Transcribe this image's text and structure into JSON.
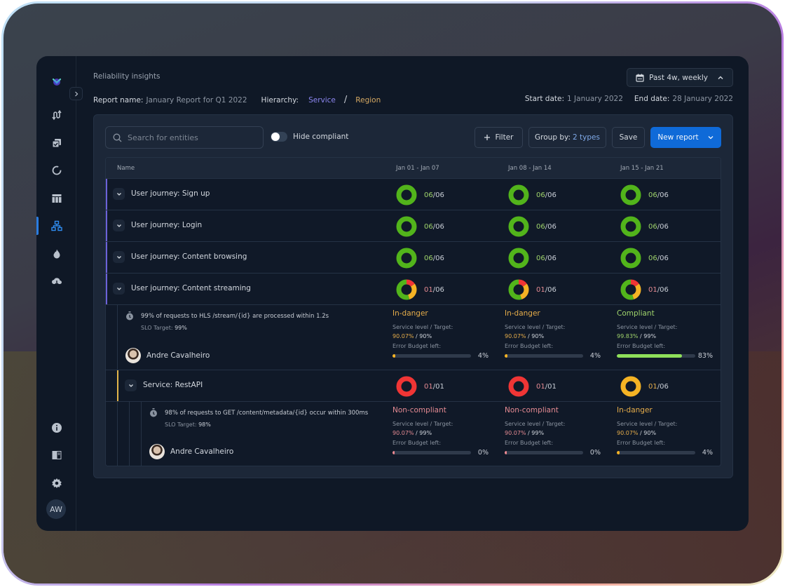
{
  "app": {
    "page_title": "Reliability insights",
    "user_initials": "AW"
  },
  "sidebar": {
    "items": [
      {
        "icon": "logo-icon",
        "active": false
      },
      {
        "icon": "route-icon",
        "active": false
      },
      {
        "icon": "copy-check-icon",
        "active": false
      },
      {
        "icon": "refresh-circle-icon",
        "active": false
      },
      {
        "icon": "table-icon",
        "active": false
      },
      {
        "icon": "hierarchy-icon",
        "active": true
      },
      {
        "icon": "flame-icon",
        "active": false
      },
      {
        "icon": "cloud-download-icon",
        "active": false
      }
    ],
    "bottom_items": [
      {
        "icon": "info-icon"
      },
      {
        "icon": "book-icon"
      },
      {
        "icon": "settings-icon"
      }
    ]
  },
  "header": {
    "report_name_label": "Report name:",
    "report_name_value": "January Report for Q1 2022",
    "hierarchy_label": "Hierarchy:",
    "hierarchy_service": "Service",
    "hierarchy_separator": "/",
    "hierarchy_region": "Region",
    "date_range_button": "Past 4w, weekly",
    "start_date_label": "Start date:",
    "start_date_value": "1 January 2022",
    "end_date_label": "End date:",
    "end_date_value": "28 January 2022"
  },
  "toolbar": {
    "search_placeholder": "Search for entities",
    "hide_compliant_label": "Hide compliant",
    "hide_compliant_on": false,
    "filter_label": "Filter",
    "group_by_label": "Group by:",
    "group_by_value": "2 types",
    "save_label": "Save",
    "new_report_label": "New report"
  },
  "table": {
    "columns": [
      "Name",
      "Jan 01 - Jan 07",
      "Jan 08 - Jan 14",
      "Jan 15 - Jan 21"
    ],
    "journeys": [
      {
        "name": "User journey: Sign up",
        "weeks": [
          {
            "ok": "06",
            "total": "06",
            "segments": {
              "green": 1,
              "orange": 0,
              "red": 0
            }
          },
          {
            "ok": "06",
            "total": "06",
            "segments": {
              "green": 1,
              "orange": 0,
              "red": 0
            }
          },
          {
            "ok": "06",
            "total": "06",
            "segments": {
              "green": 1,
              "orange": 0,
              "red": 0
            }
          }
        ]
      },
      {
        "name": "User journey: Login",
        "weeks": [
          {
            "ok": "06",
            "total": "06",
            "segments": {
              "green": 1,
              "orange": 0,
              "red": 0
            }
          },
          {
            "ok": "06",
            "total": "06",
            "segments": {
              "green": 1,
              "orange": 0,
              "red": 0
            }
          },
          {
            "ok": "06",
            "total": "06",
            "segments": {
              "green": 1,
              "orange": 0,
              "red": 0
            }
          }
        ]
      },
      {
        "name": "User journey: Content browsing",
        "weeks": [
          {
            "ok": "06",
            "total": "06",
            "segments": {
              "green": 1,
              "orange": 0,
              "red": 0
            }
          },
          {
            "ok": "06",
            "total": "06",
            "segments": {
              "green": 1,
              "orange": 0,
              "red": 0
            }
          },
          {
            "ok": "06",
            "total": "06",
            "segments": {
              "green": 1,
              "orange": 0,
              "red": 0
            }
          }
        ]
      },
      {
        "name": "User journey: Content streaming",
        "weeks": [
          {
            "ok": "01",
            "total": "06",
            "segments": {
              "green": 0.55,
              "orange": 0.3,
              "red": 0.15
            }
          },
          {
            "ok": "01",
            "total": "06",
            "segments": {
              "green": 0.55,
              "orange": 0.3,
              "red": 0.15
            }
          },
          {
            "ok": "01",
            "total": "06",
            "segments": {
              "green": 0.55,
              "orange": 0.3,
              "red": 0.15
            }
          }
        ]
      }
    ],
    "streaming_slo": {
      "text": "99% of requests to HLS /stream/{id} are processed within 1.2s",
      "target_label": "SLO Target:",
      "target_value": "99%",
      "owner": "Andre Cavalheiro",
      "weeks": [
        {
          "status": "In-danger",
          "level": "90.07%",
          "target": "90%",
          "budget_pct": 4,
          "budget_label": "4%"
        },
        {
          "status": "In-danger",
          "level": "90.07%",
          "target": "90%",
          "budget_pct": 4,
          "budget_label": "4%"
        },
        {
          "status": "Compliant",
          "level": "99.83%",
          "target": "99%",
          "budget_pct": 83,
          "budget_label": "83%"
        }
      ]
    },
    "service": {
      "name": "Service: RestAPI",
      "weeks": [
        {
          "ok": "01",
          "total": "01",
          "segments": {
            "green": 0,
            "orange": 0,
            "red": 1
          }
        },
        {
          "ok": "01",
          "total": "01",
          "segments": {
            "green": 0,
            "orange": 0,
            "red": 1
          }
        },
        {
          "ok": "01",
          "total": "06",
          "segments": {
            "green": 0,
            "orange": 1,
            "red": 0
          }
        }
      ]
    },
    "service_slo": {
      "text": "98% of requests to GET /content/metadata/{id} occur within 300ms",
      "target_label": "SLO Target:",
      "target_value": "98%",
      "owner": "Andre Cavalheiro",
      "weeks": [
        {
          "status": "Non-compliant",
          "level": "90.07%",
          "target": "99%",
          "budget_pct": 0,
          "budget_label": "0%"
        },
        {
          "status": "Non-compliant",
          "level": "90.07%",
          "target": "99%",
          "budget_pct": 0,
          "budget_label": "0%"
        },
        {
          "status": "In-danger",
          "level": "90.07%",
          "target": "90%",
          "budget_pct": 4,
          "budget_label": "4%"
        }
      ]
    },
    "labels": {
      "service_level": "Service level / Target:",
      "error_budget": "Error Budget left:"
    }
  },
  "colors": {
    "green": "#52b41b",
    "orange": "#f5b324",
    "red": "#f03535",
    "compliant_text": "#9fd36b",
    "danger_text": "#e6ad4a",
    "noncompliant_text": "#e48a92",
    "bar_green": "#8fe05a",
    "bar_orange": "#f5b324",
    "bar_red": "#f08a92",
    "accent_blue": "#0f6ad8"
  }
}
